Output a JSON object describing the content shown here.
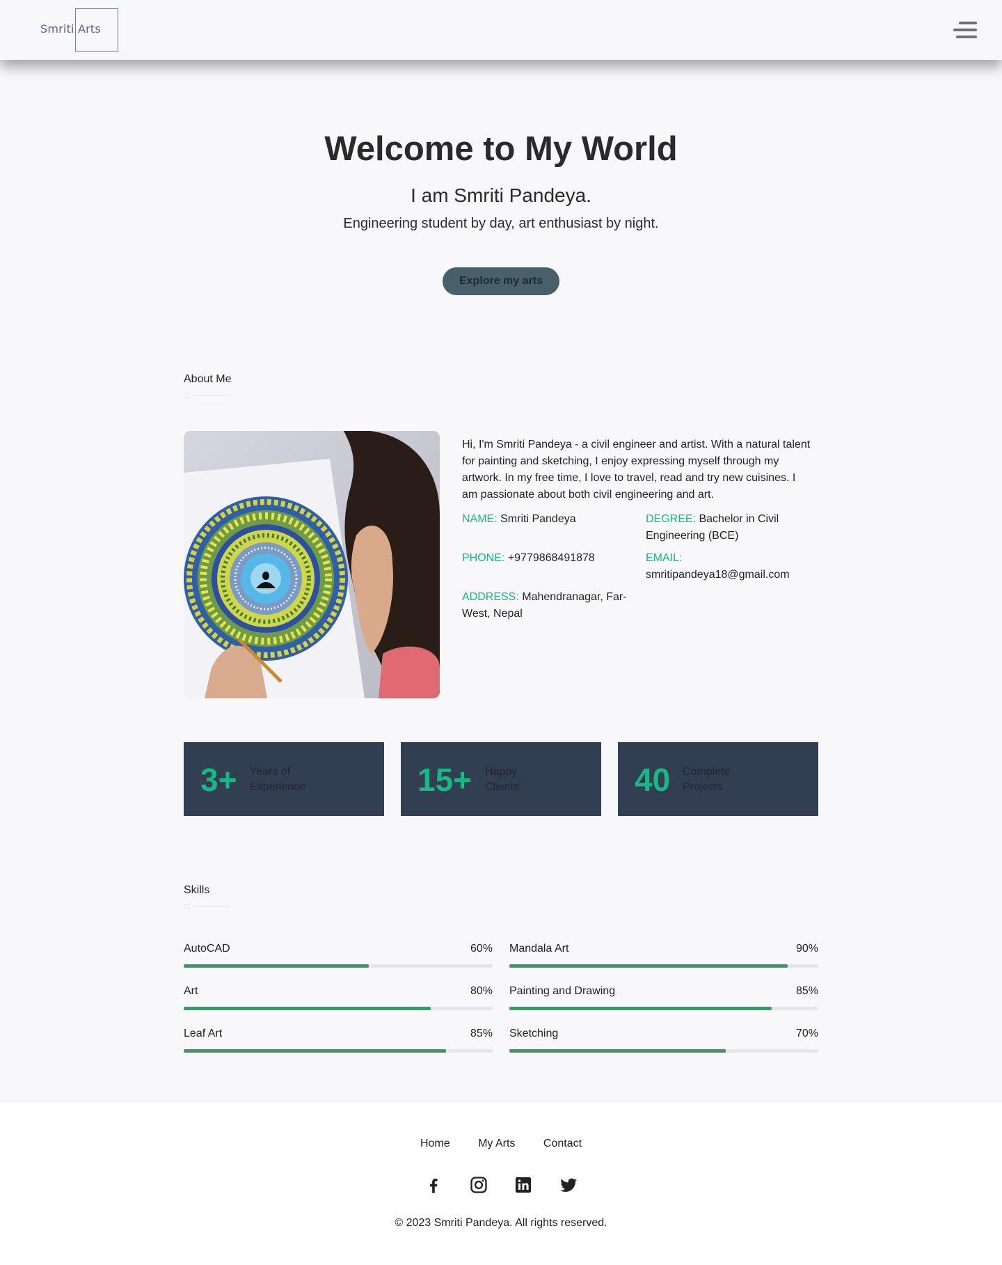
{
  "header": {
    "logo_text": "Smriti Arts",
    "menu_icon": "hamburger-menu-icon"
  },
  "hero": {
    "title": "Welcome to My World",
    "subtitle": "I am Smriti Pandeya.",
    "tagline": "Engineering student by day, art enthusiast by night.",
    "cta_label": "Explore my arts"
  },
  "about": {
    "heading": "About Me",
    "bio": "Hi, I'm Smriti Pandeya - a civil engineer and artist. With a natural talent for painting and sketching, I enjoy expressing myself through my artwork. In my free time, I love to travel, read and try new cuisines. I am passionate about both civil engineering and art.",
    "info": {
      "name_label": "NAME:",
      "name_value": "Smriti Pandeya",
      "degree_label": "DEGREE:",
      "degree_value": "Bachelor in Civil Engineering (BCE)",
      "phone_label": "PHONE:",
      "phone_value": "+9779868491878",
      "email_label": "EMAIL:",
      "email_value": "smritipandeya18@gmail.com",
      "address_label": "ADDRESS:",
      "address_value": "Mahendranagar, Far-West, Nepal"
    }
  },
  "stats": [
    {
      "number": "3+",
      "label": "Years of Experience"
    },
    {
      "number": "15+",
      "label": "Happy Clients"
    },
    {
      "number": "40",
      "label": "Complete Projects"
    }
  ],
  "skills": {
    "heading": "Skills",
    "items": [
      {
        "name": "AutoCAD",
        "percent_label": "60%",
        "level": 0.6
      },
      {
        "name": "Mandala Art",
        "percent_label": "90%",
        "level": 0.9
      },
      {
        "name": "Art",
        "percent_label": "80%",
        "level": 0.8
      },
      {
        "name": "Painting and Drawing",
        "percent_label": "85%",
        "level": 0.85
      },
      {
        "name": "Leaf Art",
        "percent_label": "85%",
        "level": 0.85
      },
      {
        "name": "Sketching",
        "percent_label": "70%",
        "level": 0.7
      }
    ]
  },
  "footer": {
    "nav": [
      "Home",
      "My Arts",
      "Contact"
    ],
    "social_icons": [
      "facebook-icon",
      "instagram-icon",
      "linkedin-icon",
      "twitter-icon"
    ],
    "copyright": "© 2023 Smriti Pandeya. All rights reserved."
  },
  "colors": {
    "accent_green": "#14b884",
    "stat_card_bg": "#323f52",
    "skill_bar": "#41956a",
    "cta_bg": "#47606a"
  }
}
